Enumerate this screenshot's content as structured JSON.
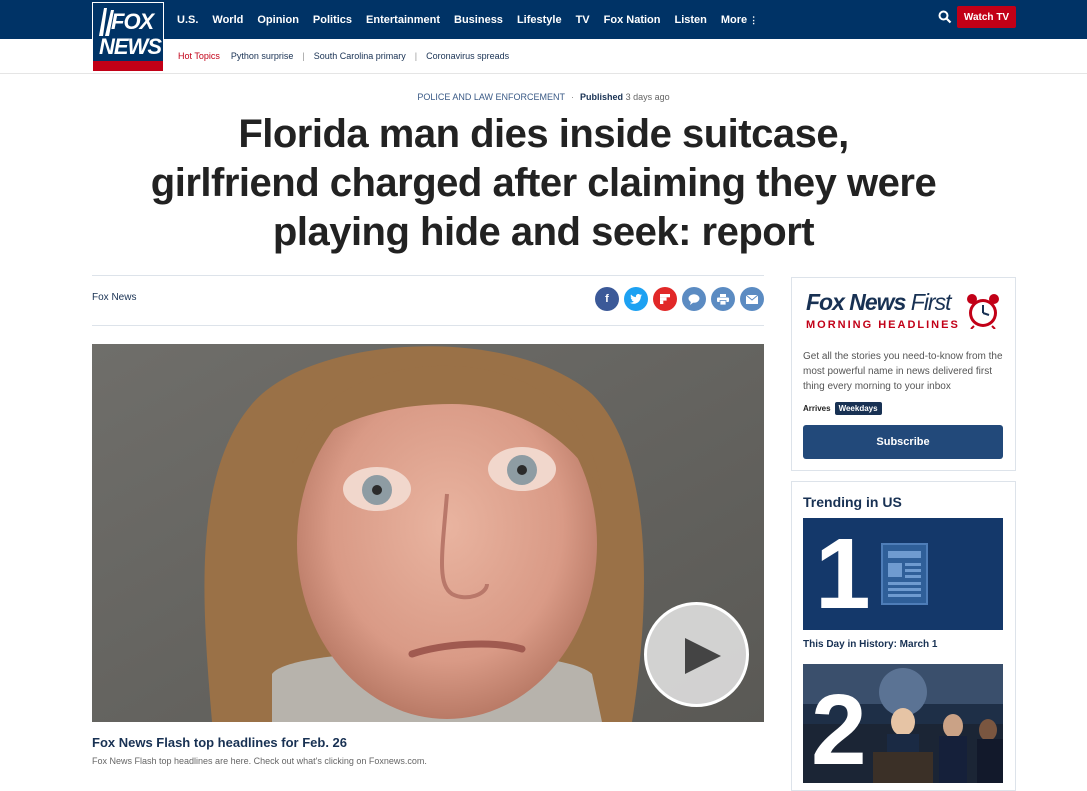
{
  "brand": {
    "logo_line1": "FOX",
    "logo_line2": "NEWS"
  },
  "nav": {
    "items": [
      "U.S.",
      "World",
      "Opinion",
      "Politics",
      "Entertainment",
      "Business",
      "Lifestyle",
      "TV",
      "Fox Nation",
      "Listen",
      "More"
    ],
    "watch_tv": "Watch TV",
    "search_icon": "search-icon",
    "more_icon": "vertical-dots-icon"
  },
  "hot_topics": {
    "label": "Hot Topics",
    "items": [
      "Python surprise",
      "South Carolina primary",
      "Coronavirus spreads"
    ]
  },
  "article": {
    "category": "POLICE AND LAW ENFORCEMENT",
    "published_label": "Published",
    "published_time": "3 days ago",
    "headline": "Florida man dies inside suitcase, girlfriend charged after claiming they were playing hide and seek: report",
    "author": "Fox News",
    "share_icons": [
      "facebook-icon",
      "twitter-icon",
      "flipboard-icon",
      "comments-icon",
      "print-icon",
      "email-icon"
    ]
  },
  "video": {
    "title": "Fox News Flash top headlines for Feb. 26",
    "description": "Fox News Flash top headlines are here. Check out what's clicking on Foxnews.com."
  },
  "newsletter": {
    "brand": "Fox News",
    "brand_suffix": "First",
    "subtitle": "MORNING HEADLINES",
    "description": "Get all the stories you need-to-know from the most powerful name in news delivered first thing every morning to your inbox",
    "arrives_label": "Arrives",
    "arrives_value": "Weekdays",
    "subscribe": "Subscribe"
  },
  "trending": {
    "title": "Trending in US",
    "items": [
      {
        "rank": "1",
        "caption": "This Day in History: March 1"
      },
      {
        "rank": "2",
        "caption": ""
      }
    ]
  },
  "colors": {
    "navy": "#003366",
    "red": "#c20017",
    "button_blue": "#22497a"
  }
}
